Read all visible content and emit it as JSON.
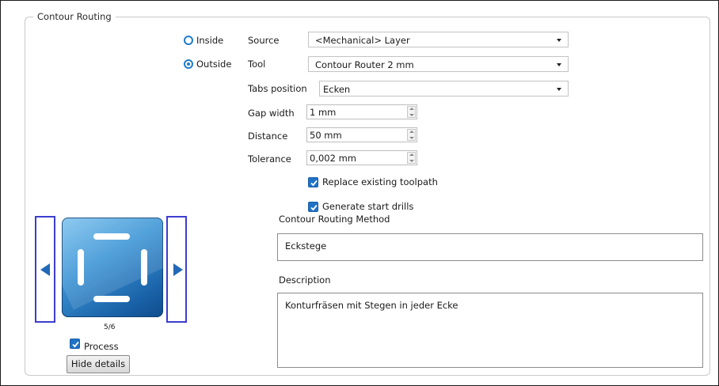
{
  "group": {
    "title": "Contour Routing"
  },
  "side": {
    "inside_label": "Inside",
    "outside_label": "Outside",
    "selected": "outside"
  },
  "fields": {
    "source_label": "Source",
    "source_value": "<Mechanical> Layer",
    "tool_label": "Tool",
    "tool_value": "Contour Router 2 mm",
    "tabs_position_label": "Tabs position",
    "tabs_position_value": "Ecken",
    "gap_width_label": "Gap width",
    "gap_width_value": "1 mm",
    "distance_label": "Distance",
    "distance_value": "50 mm",
    "tolerance_label": "Tolerance",
    "tolerance_value": "0,002 mm"
  },
  "options": {
    "replace_toolpath_label": "Replace existing toolpath",
    "replace_toolpath_checked": true,
    "generate_drills_label": "Generate start drills",
    "generate_drills_checked": true
  },
  "method": {
    "heading": "Contour Routing Method",
    "value": "Eckstege",
    "description_heading": "Description",
    "description_value": "Konturfräsen mit Stegen in jeder Ecke"
  },
  "carousel": {
    "counter": "5/6",
    "icon": "contour-routing-corner-tabs-icon"
  },
  "footer": {
    "process_label": "Process",
    "process_checked": true,
    "hide_details_label": "Hide details"
  },
  "colors": {
    "accent": "#1e7ccf",
    "checkbox": "#1f72c6",
    "nav_border": "#3d3dd0",
    "tile": "#1a62a8"
  }
}
